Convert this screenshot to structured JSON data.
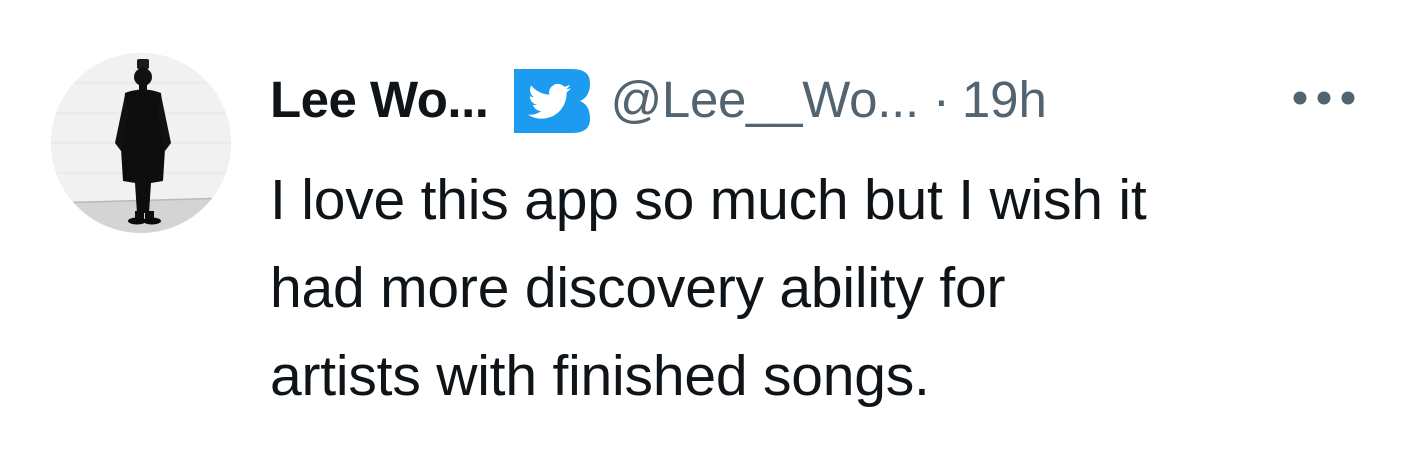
{
  "tweet": {
    "author": {
      "display_name": "Lee Wo...",
      "handle": "@Lee__Wo...",
      "badge_icon": "twitter-bird-icon",
      "avatar_icon": "avatar-photo"
    },
    "separator": "·",
    "timestamp": "19h",
    "more_icon": "more-dots-icon",
    "text_lines": [
      "I love this app so much but I wish it",
      "had more discovery ability for",
      "artists with finished songs."
    ]
  },
  "colors": {
    "text_primary": "#0f1419",
    "text_secondary": "#536471",
    "brand_blue": "#1d9bf0",
    "background": "#ffffff"
  }
}
